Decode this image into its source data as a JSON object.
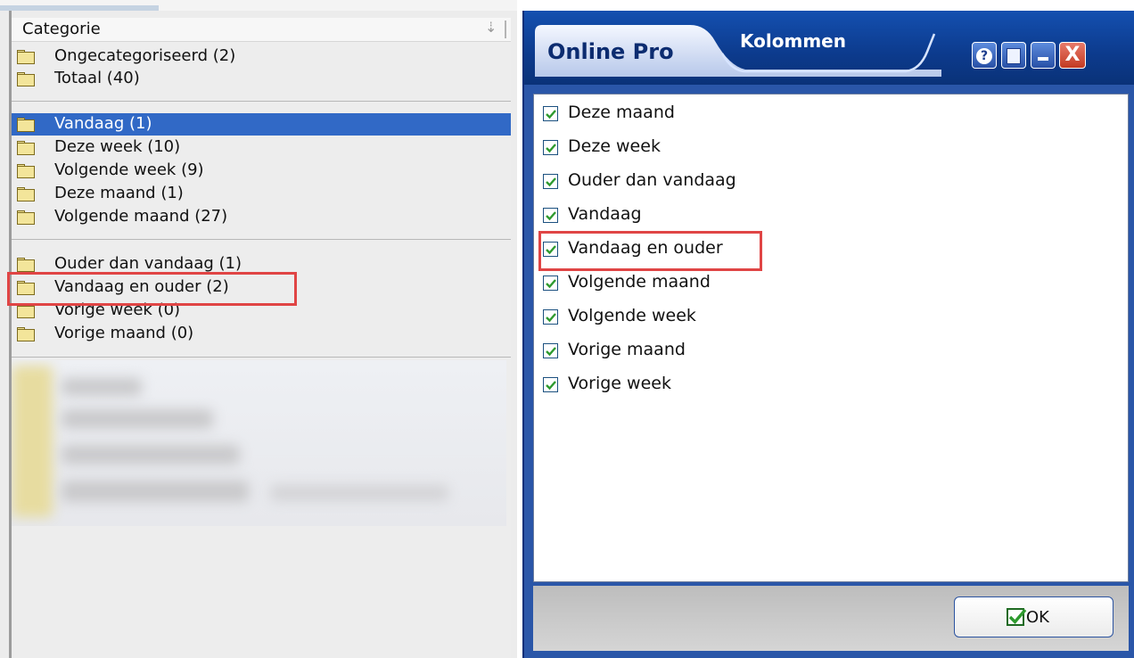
{
  "category_panel": {
    "header": "Categorie",
    "sort_icon": "arrow-down-icon",
    "group1": [
      "Ongecategoriseerd (2)",
      "Totaal (40)"
    ],
    "group2": [
      "Vandaag (1)",
      "Deze week (10)",
      "Volgende week (9)",
      "Deze maand (1)",
      "Volgende maand (27)"
    ],
    "group3": [
      "Ouder dan vandaag (1)",
      "Vandaag en ouder (2)",
      "Vorige week (0)",
      "Vorige maand (0)"
    ],
    "selected_item": "Vandaag (1)",
    "highlighted_item": "Vandaag en ouder (2)",
    "folder_icon": "folder-icon"
  },
  "dialog": {
    "app_name": "Online Pro",
    "title": "Kolommen",
    "buttons": {
      "help": "?",
      "close": "X"
    },
    "columns": [
      {
        "label": "Deze maand",
        "checked": true
      },
      {
        "label": "Deze week",
        "checked": true
      },
      {
        "label": "Ouder dan vandaag",
        "checked": true
      },
      {
        "label": "Vandaag",
        "checked": true
      },
      {
        "label": "Vandaag en ouder",
        "checked": true
      },
      {
        "label": "Volgende maand",
        "checked": true
      },
      {
        "label": "Volgende week",
        "checked": true
      },
      {
        "label": "Vorige maand",
        "checked": true
      },
      {
        "label": "Vorige week",
        "checked": true
      }
    ],
    "highlighted_column": "Vandaag en ouder",
    "ok_label": "OK"
  },
  "colors": {
    "selection": "#3169c6",
    "highlight": "#e04545",
    "title_bar": "#0c3a8c",
    "check": "#2e9a2e"
  }
}
